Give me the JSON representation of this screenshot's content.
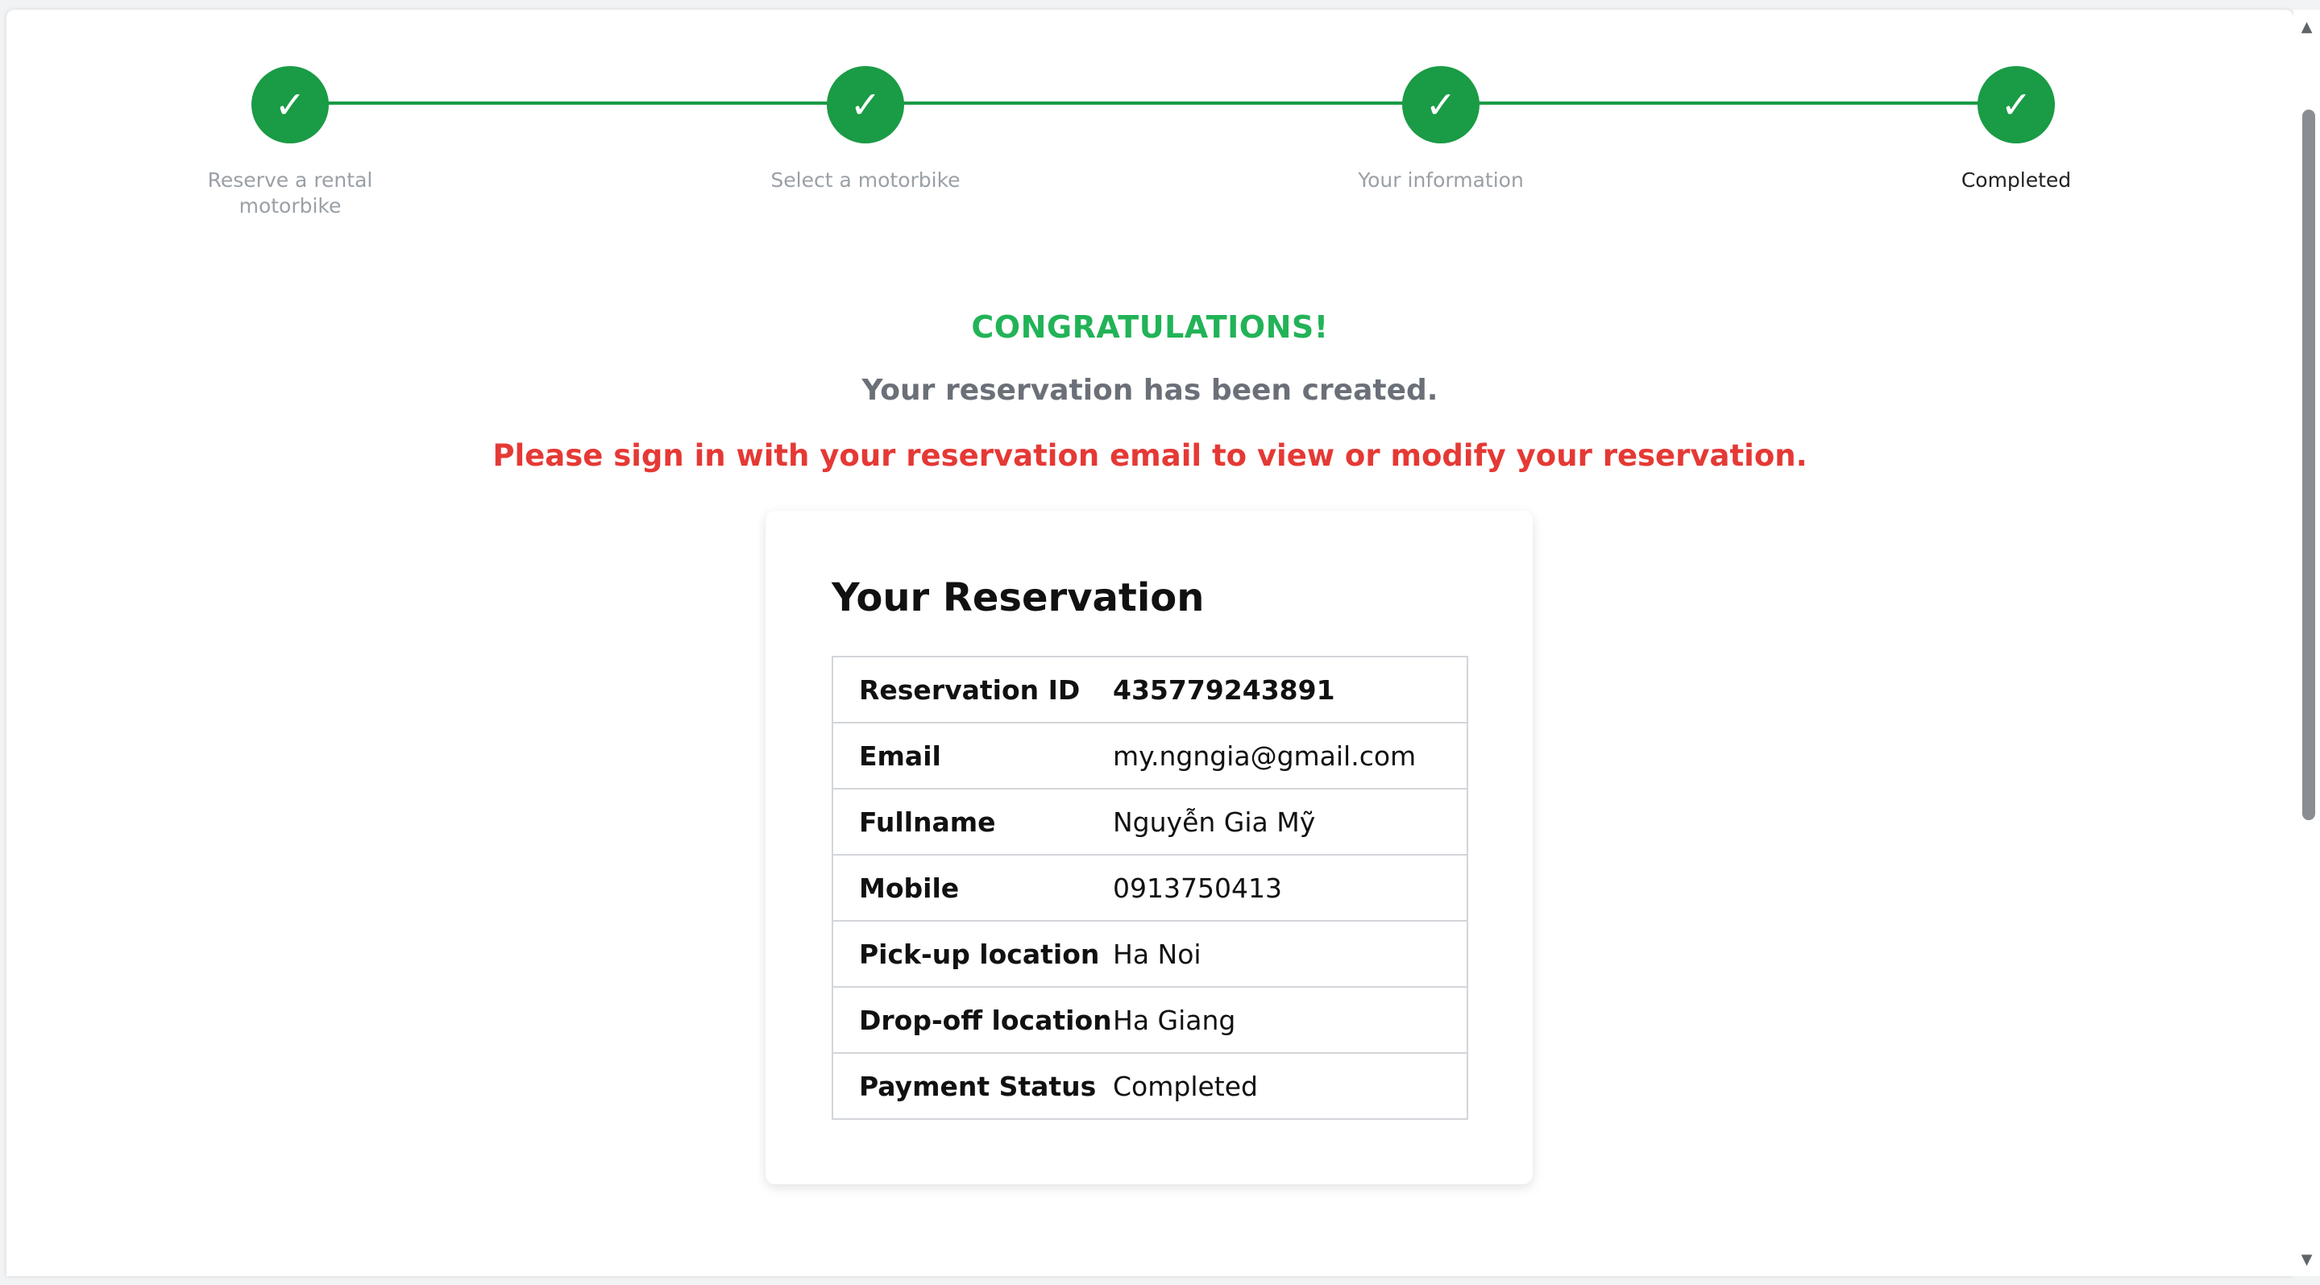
{
  "stepper": {
    "steps": [
      {
        "label": "Reserve a rental motorbike",
        "check": "✓",
        "icon": "check-icon"
      },
      {
        "label": "Select a motorbike",
        "check": "✓",
        "icon": "check-icon"
      },
      {
        "label": "Your information",
        "check": "✓",
        "icon": "check-icon"
      },
      {
        "label": "Completed",
        "check": "✓",
        "icon": "check-icon"
      }
    ],
    "color": "#1a9b45"
  },
  "messages": {
    "congrats": "CONGRATULATIONS!",
    "created": "Your reservation has been created.",
    "signin": "Please sign in with your reservation email to view or modify your reservation."
  },
  "reservation": {
    "title": "Your Reservation",
    "rows": [
      {
        "label": "Reservation ID",
        "value": "435779243891"
      },
      {
        "label": "Email",
        "value": "my.ngngia@gmail.com"
      },
      {
        "label": "Fullname",
        "value": "Nguyễn Gia Mỹ"
      },
      {
        "label": "Mobile",
        "value": "0913750413"
      },
      {
        "label": "Pick-up location",
        "value": "Ha Noi"
      },
      {
        "label": "Drop-off location",
        "value": "Ha Giang"
      },
      {
        "label": "Payment Status",
        "value": "Completed"
      }
    ]
  },
  "scrollbar": {
    "up": "▲",
    "down": "▼"
  },
  "colors": {
    "success": "#22b357",
    "danger": "#e53935",
    "muted": "#6b7078"
  }
}
